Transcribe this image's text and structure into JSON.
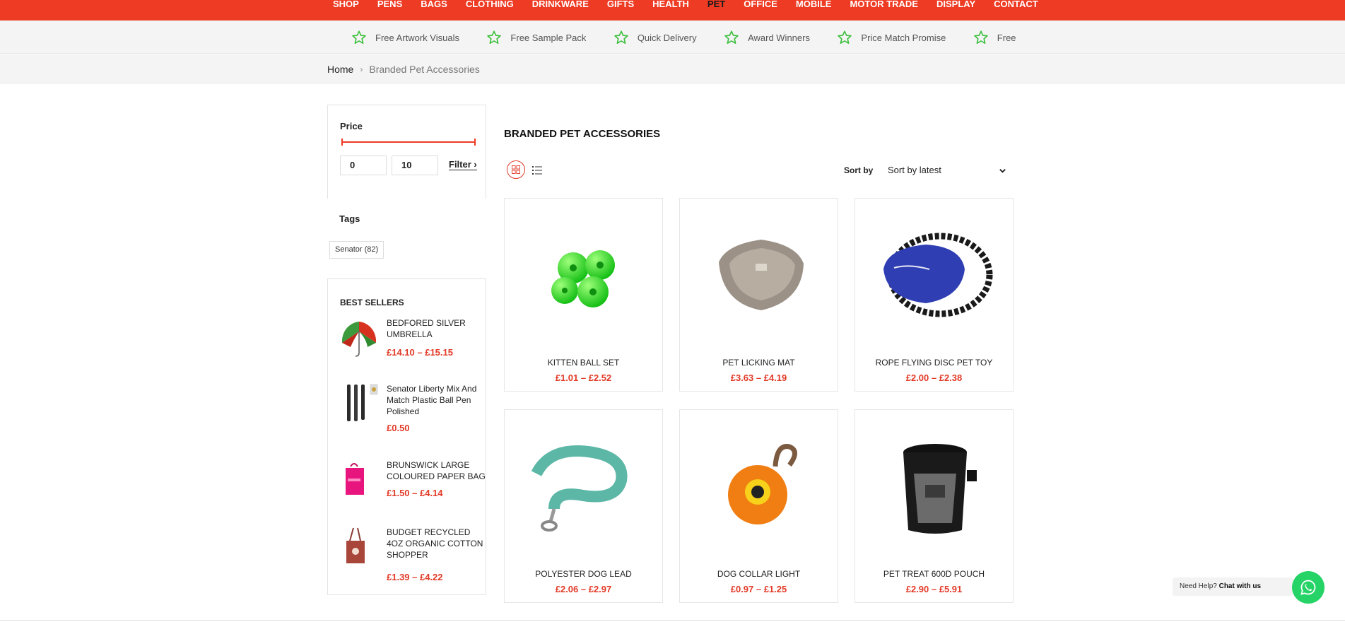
{
  "nav": {
    "items": [
      "SHOP",
      "PENS",
      "BAGS",
      "CLOTHING",
      "DRINKWARE",
      "GIFTS",
      "HEALTH",
      "PET",
      "OFFICE",
      "MOBILE",
      "MOTOR TRADE",
      "DISPLAY",
      "CONTACT"
    ],
    "active": "PET"
  },
  "usp": {
    "items": [
      "Free Artwork Visuals",
      "Free Sample Pack",
      "Quick Delivery",
      "Award Winners",
      "Price Match Promise",
      "Free Artw"
    ],
    "icon": "star-outline-icon",
    "icon_color": "#3bbf3b"
  },
  "breadcrumb": {
    "home": "Home",
    "separator": "›",
    "current": "Branded Pet Accessories"
  },
  "filters": {
    "price_title": "Price",
    "min_value": "0",
    "max_value": "10",
    "filter_label": "Filter ›",
    "tags_title": "Tags",
    "tag": "Senator (82)"
  },
  "best_sellers": {
    "title": "BEST SELLERS",
    "items": [
      {
        "name": "BEDFORED SILVER UMBRELLA",
        "price": "£14.10 – £15.15"
      },
      {
        "name": "Senator Liberty Mix And Match Plastic Ball Pen Polished",
        "price": "£0.50"
      },
      {
        "name": "BRUNSWICK LARGE COLOURED PAPER BAG",
        "price": "£1.50 – £4.14"
      },
      {
        "name": "BUDGET RECYCLED 4OZ ORGANIC COTTON SHOPPER",
        "price": "£1.39 – £4.22"
      }
    ]
  },
  "main": {
    "title": "BRANDED PET ACCESSORIES",
    "sort_label": "Sort by",
    "sort_value": "Sort by latest"
  },
  "products": [
    {
      "name": "KITTEN BALL SET",
      "price": "£1.01 – £2.52"
    },
    {
      "name": "PET LICKING MAT",
      "price": "£3.63 – £4.19"
    },
    {
      "name": "ROPE FLYING DISC PET TOY",
      "price": "£2.00 – £2.38"
    },
    {
      "name": "POLYESTER DOG LEAD",
      "price": "£2.06 – £2.97"
    },
    {
      "name": "DOG COLLAR LIGHT",
      "price": "£0.97 – £1.25"
    },
    {
      "name": "PET TREAT 600D POUCH",
      "price": "£2.90 – £5.91"
    }
  ],
  "help": {
    "prefix": "Need Help?",
    "link": "Chat with us"
  },
  "colors": {
    "brand_red": "#ee3b24",
    "price_red": "#e23a27",
    "whatsapp_green": "#25d366"
  }
}
